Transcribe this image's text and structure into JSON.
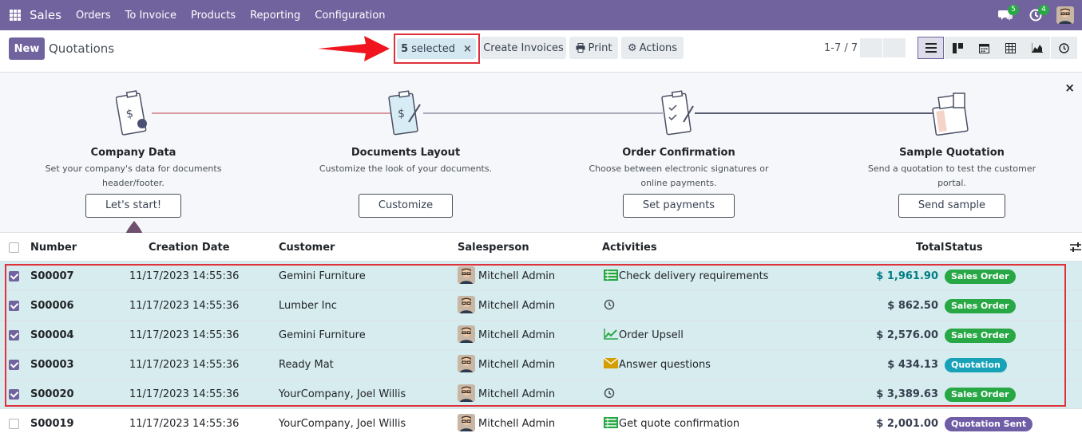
{
  "navbar": {
    "brand": "Sales",
    "menu": [
      "Orders",
      "To Invoice",
      "Products",
      "Reporting",
      "Configuration"
    ],
    "messages_count": "5",
    "activities_count": "4"
  },
  "control_panel": {
    "new_label": "New",
    "breadcrumb": "Quotations",
    "selected_count": "5",
    "selected_label": "selected",
    "clear_selection": "×",
    "create_invoices_label": "Create Invoices",
    "print_label": "Print",
    "actions_label": "Actions",
    "pager": "1-7 / 7"
  },
  "onboarding": {
    "close_label": "×",
    "steps": [
      {
        "title": "Company Data",
        "desc_1": "Set your company's data for documents",
        "desc_2": "header/footer.",
        "button": "Let's start!"
      },
      {
        "title": "Documents Layout",
        "desc_1": "Customize the look of your documents.",
        "desc_2": "",
        "button": "Customize"
      },
      {
        "title": "Order Confirmation",
        "desc_1": "Choose between electronic signatures or",
        "desc_2": "online payments.",
        "button": "Set payments"
      },
      {
        "title": "Sample Quotation",
        "desc_1": "Send a quotation to test the customer",
        "desc_2": "portal.",
        "button": "Send sample"
      }
    ]
  },
  "table": {
    "headers": {
      "number": "Number",
      "creation_date": "Creation Date",
      "customer": "Customer",
      "salesperson": "Salesperson",
      "activities": "Activities",
      "total": "Total",
      "status": "Status"
    },
    "rows": [
      {
        "number": "S00007",
        "date": "11/17/2023 14:55:36",
        "customer": "Gemini Furniture",
        "salesperson": "Mitchell Admin",
        "activity": "Check delivery requirements",
        "activity_icon": "list-icon",
        "total": "$ 1,961.90",
        "status": "Sales Order",
        "selected": true
      },
      {
        "number": "S00006",
        "date": "11/17/2023 14:55:36",
        "customer": "Lumber Inc",
        "salesperson": "Mitchell Admin",
        "activity": "",
        "activity_icon": "clock-icon",
        "total": "$ 862.50",
        "status": "Sales Order",
        "selected": true
      },
      {
        "number": "S00004",
        "date": "11/17/2023 14:55:36",
        "customer": "Gemini Furniture",
        "salesperson": "Mitchell Admin",
        "activity": "Order Upsell",
        "activity_icon": "chart-icon",
        "total": "$ 2,576.00",
        "status": "Sales Order",
        "selected": true
      },
      {
        "number": "S00003",
        "date": "11/17/2023 14:55:36",
        "customer": "Ready Mat",
        "salesperson": "Mitchell Admin",
        "activity": "Answer questions",
        "activity_icon": "envelope-icon",
        "total": "$ 434.13",
        "status": "Quotation",
        "selected": true
      },
      {
        "number": "S00020",
        "date": "11/17/2023 14:55:36",
        "customer": "YourCompany, Joel Willis",
        "salesperson": "Mitchell Admin",
        "activity": "",
        "activity_icon": "clock-icon",
        "total": "$ 3,389.63",
        "status": "Sales Order",
        "selected": true
      },
      {
        "number": "S00019",
        "date": "11/17/2023 14:55:36",
        "customer": "YourCompany, Joel Willis",
        "salesperson": "Mitchell Admin",
        "activity": "Get quote confirmation",
        "activity_icon": "list-icon",
        "total": "$ 2,001.00",
        "status": "Quotation Sent",
        "selected": false
      }
    ]
  },
  "colors": {
    "brand": "#71639e",
    "selected_row": "#d7ecee",
    "status_sales_order": "#28a745",
    "status_quotation": "#17a2b8",
    "status_quotation_sent": "#6f5ea6",
    "annotation_red": "#e0303a",
    "first_total": "#017e84"
  }
}
